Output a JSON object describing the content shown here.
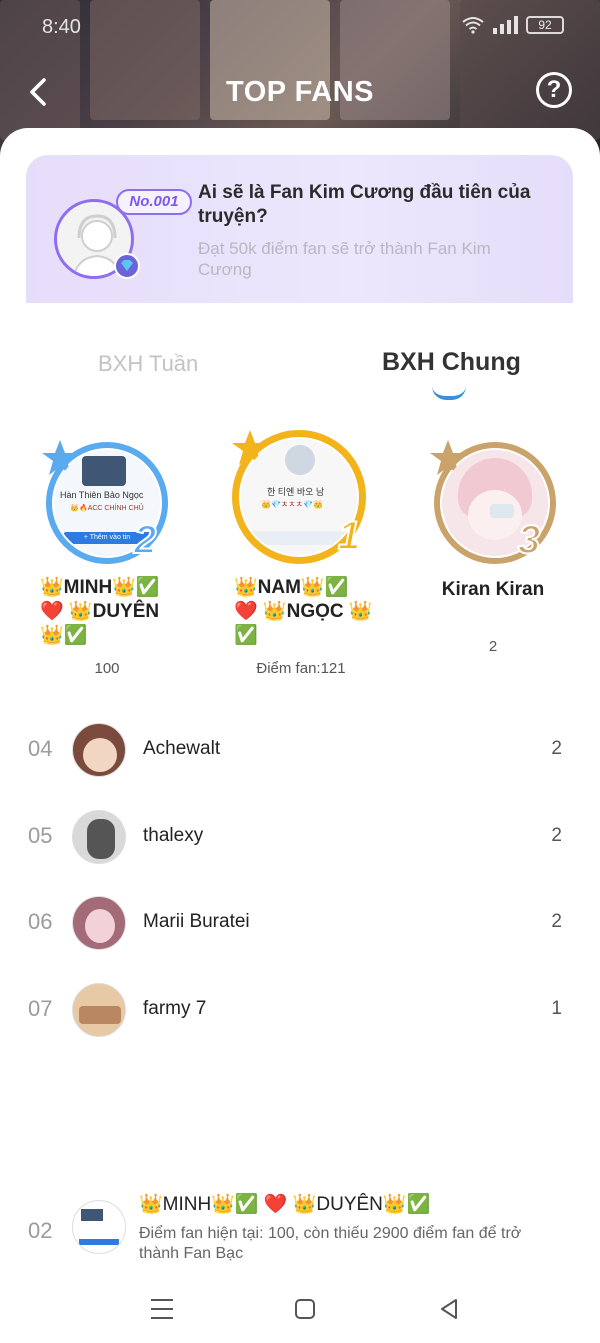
{
  "status_bar": {
    "time": "8:40",
    "battery": "92"
  },
  "header": {
    "title": "TOP FANS",
    "help_symbol": "?"
  },
  "promo": {
    "badge": "No.001",
    "title": "Ai sẽ là Fan Kim Cương đầu tiên của truyện?",
    "subtitle": "Đạt 50k điểm fan sẽ trở thành Fan Kim Cương"
  },
  "tabs": [
    {
      "label": "BXH Tuần",
      "active": false
    },
    {
      "label": "BXH Chung",
      "active": true
    }
  ],
  "podium": [
    {
      "rank": "2",
      "name": "👑MINH👑✅ ❤️ 👑DUYÊN 👑✅",
      "score": "100",
      "ring_color": "#5aaaf0"
    },
    {
      "rank": "1",
      "name": "👑NAM👑✅ ❤️ 👑NGỌC 👑✅",
      "score": "Điểm fan:121",
      "ring_color": "#f3b31a"
    },
    {
      "rank": "3",
      "name": "Kiran Kiran",
      "score": "2",
      "ring_color": "#c9a36a"
    }
  ],
  "podium_snippets": {
    "rank2_line1": "Hàn Thiên Bảo Ngọc",
    "rank2_button": "+ Thêm vào tin",
    "rank1_line1": "한 티엔 바오 남"
  },
  "list": [
    {
      "rank": "04",
      "name": "Achewalt",
      "score": "2"
    },
    {
      "rank": "05",
      "name": "thalexy",
      "score": "2"
    },
    {
      "rank": "06",
      "name": "Marii Buratei",
      "score": "2"
    },
    {
      "rank": "07",
      "name": "farmy 7",
      "score": "1"
    }
  ],
  "me": {
    "rank": "02",
    "name": "👑MINH👑✅ ❤️ 👑DUYÊN👑✅",
    "info": "Điểm fan hiện tại: 100, còn thiếu 2900 điểm fan để trở thành Fan Bạc"
  },
  "colors": {
    "accent_purple": "#8e6df0",
    "tab_indicator": "#3d8fdb"
  }
}
